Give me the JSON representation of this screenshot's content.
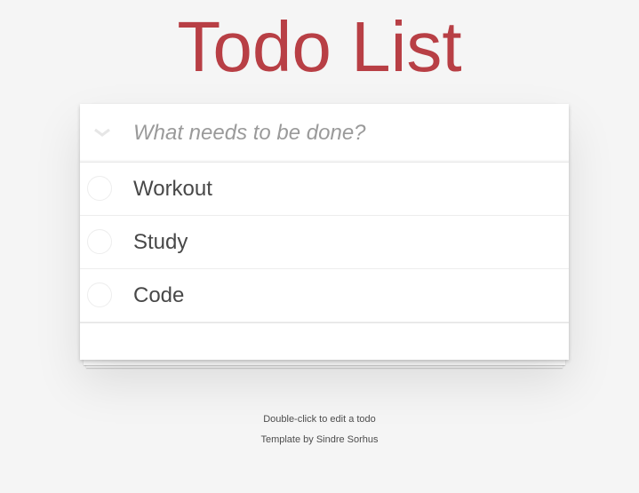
{
  "title": "Todo List",
  "new_todo": {
    "placeholder": "What needs to be done?",
    "value": ""
  },
  "toggle_all_icon": "chevron-down-icon",
  "todos": [
    {
      "label": "Workout",
      "completed": false
    },
    {
      "label": "Study",
      "completed": false
    },
    {
      "label": "Code",
      "completed": false
    }
  ],
  "info": {
    "hint": "Double-click to edit a todo",
    "credit": "Template by Sindre Sorhus"
  },
  "colors": {
    "title": "#b83f45",
    "background": "#f5f5f5"
  }
}
